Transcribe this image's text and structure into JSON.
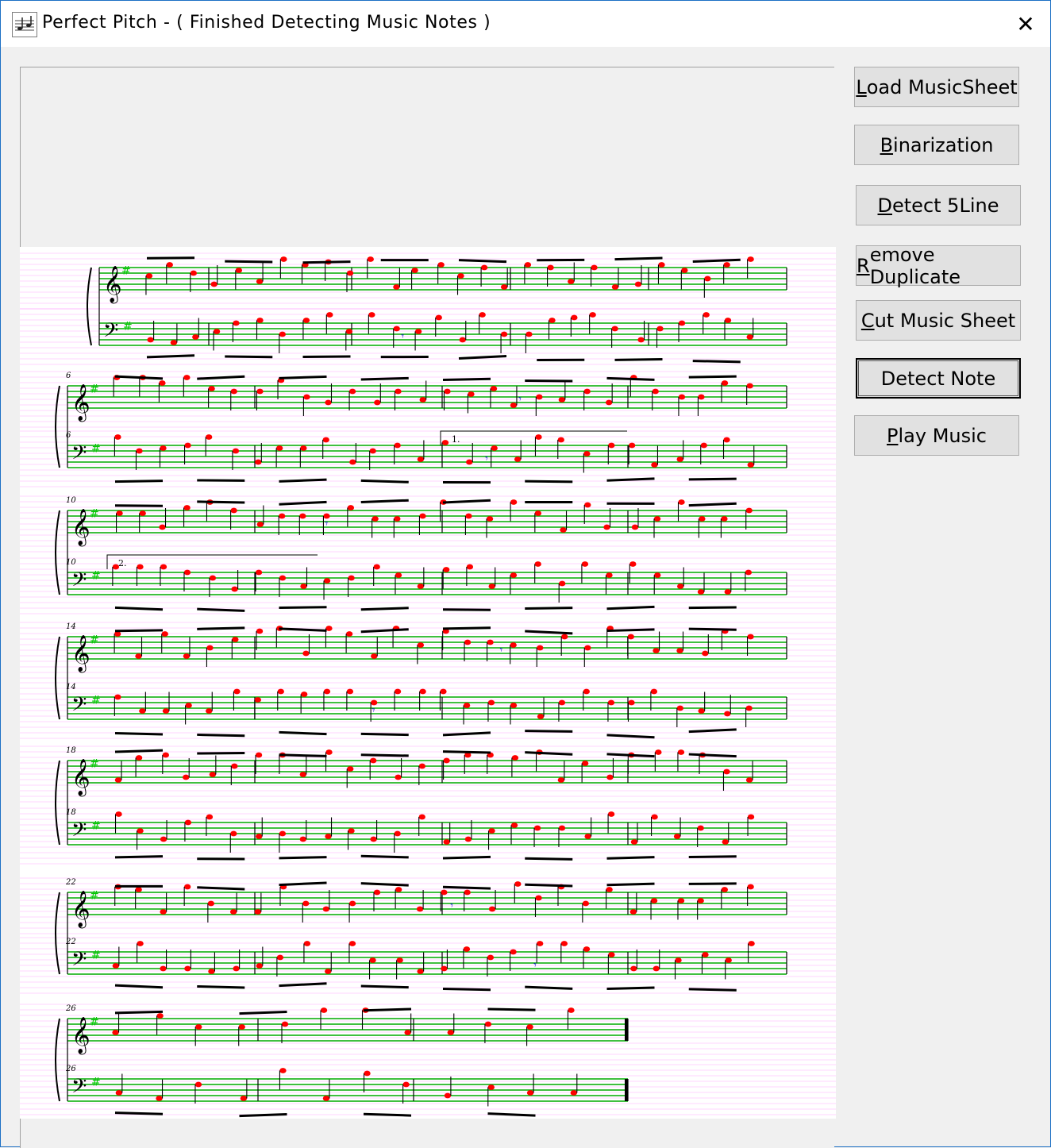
{
  "window": {
    "title": "Perfect Pitch - ( Finished Detecting Music Notes )",
    "close_glyph": "✕"
  },
  "buttons": {
    "load": {
      "accel": "L",
      "rest": "oad MusicSheet"
    },
    "binarization": {
      "accel": "B",
      "rest": "inarization"
    },
    "detect_5line": {
      "pre": "",
      "accel": "D",
      "rest": "etect 5Line"
    },
    "remove_duplicate": {
      "accel": "R",
      "rest": "emove Duplicate"
    },
    "cut_music_sheet": {
      "accel": "C",
      "rest": "ut Music Sheet"
    },
    "detect_note": {
      "label": "Detect Note"
    },
    "play_music": {
      "accel": "P",
      "rest": "lay Music"
    }
  },
  "score": {
    "measure_numbers": [
      "6",
      "6",
      "10",
      "10",
      "14",
      "14",
      "18",
      "18",
      "22",
      "22",
      "26",
      "26"
    ],
    "volta_labels": [
      "1.",
      "2."
    ],
    "colors": {
      "staff_line": "#00aa00",
      "guide_line": "#ff88ff",
      "note_head": "#ff0000",
      "rest_mark": "#0000cc",
      "accidental": "#00cc00"
    }
  }
}
